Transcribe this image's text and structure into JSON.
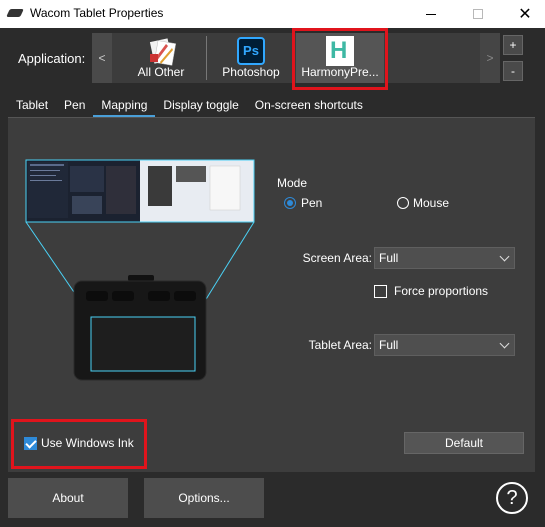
{
  "window": {
    "title": "Wacom Tablet Properties"
  },
  "appbar": {
    "label": "Application:",
    "nav_left": "<",
    "nav_right": ">",
    "add": "+",
    "remove": "-",
    "apps": [
      {
        "label": "All Other",
        "icon": "all-other-icon"
      },
      {
        "label": "Photoshop",
        "icon": "photoshop-icon",
        "icon_text": "Ps"
      },
      {
        "label": "HarmonyPre...",
        "icon": "harmony-icon",
        "icon_text": "H",
        "selected": true
      }
    ]
  },
  "tabs": [
    {
      "label": "Tablet"
    },
    {
      "label": "Pen"
    },
    {
      "label": "Mapping",
      "active": true
    },
    {
      "label": "Display toggle"
    },
    {
      "label": "On-screen shortcuts"
    }
  ],
  "mapping": {
    "mode_label": "Mode",
    "mode_options": {
      "pen": "Pen",
      "mouse": "Mouse"
    },
    "mode_selected": "Pen",
    "screen_area_label": "Screen Area:",
    "screen_area_value": "Full",
    "force_proportions_label": "Force proportions",
    "force_proportions_checked": false,
    "tablet_area_label": "Tablet Area:",
    "tablet_area_value": "Full",
    "use_windows_ink_label": "Use Windows Ink",
    "use_windows_ink_checked": true,
    "default_button": "Default"
  },
  "footer": {
    "about_button": "About",
    "options_button": "Options...",
    "help_icon": "?"
  },
  "colors": {
    "accent": "#2e8ad8",
    "highlight": "#e0141c",
    "mapping_lines": "#4ad1f5"
  }
}
